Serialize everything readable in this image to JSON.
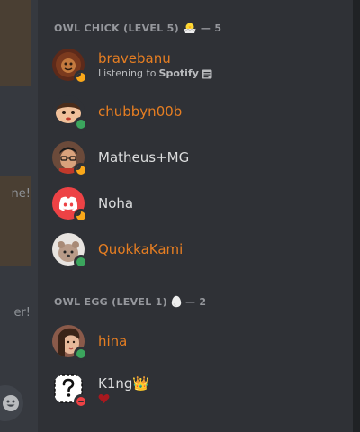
{
  "chat_fragment": {
    "line1": "ne!",
    "line2": "er!"
  },
  "groups": [
    {
      "label": "OWL CHICK (LEVEL 5)",
      "icon": "hatching-chick-icon",
      "count": "— 5"
    },
    {
      "label": "OWL EGG (LEVEL 1)",
      "icon": "egg-icon",
      "count": "— 2"
    }
  ],
  "members": [
    {
      "name": "bravebanu",
      "color": "#e67e22",
      "status": "idle",
      "activity_prefix": "Listening to",
      "activity_app": "Spotify"
    },
    {
      "name": "chubbyn00b",
      "color": "#e67e22",
      "status": "online"
    },
    {
      "name": "Matheus+MG",
      "color": "#dcddde",
      "status": "idle"
    },
    {
      "name": "Noha",
      "color": "#dcddde",
      "status": "idle"
    },
    {
      "name": "QuokkaKami",
      "color": "#e67e22",
      "status": "online"
    },
    {
      "name": "hina",
      "color": "#e67e22",
      "status": "online"
    },
    {
      "name": "K1ng👑",
      "color": "#dcddde",
      "status": "dnd",
      "custom_status_icon": "heart-icon"
    }
  ],
  "colors": {
    "background": "#2f3136",
    "orange_role": "#e67e22",
    "online": "#3ba55d",
    "idle": "#faa81a",
    "dnd": "#ed4245",
    "discord_blurple_alt": "#ed4245"
  }
}
